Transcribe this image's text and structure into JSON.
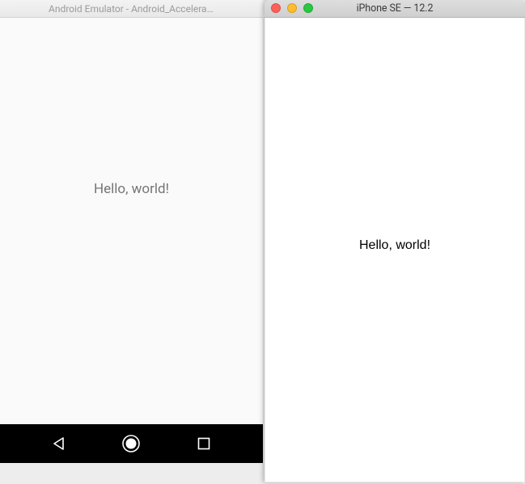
{
  "android": {
    "title": "Android Emulator - Android_Accelerated...",
    "content_text": "Hello, world!",
    "nav": {
      "back_icon": "back",
      "home_icon": "home",
      "recent_icon": "recent"
    }
  },
  "iphone": {
    "title": "iPhone SE — 12.2",
    "content_text": "Hello, world!",
    "traffic": {
      "close": "close",
      "minimize": "minimize",
      "zoom": "zoom"
    }
  }
}
